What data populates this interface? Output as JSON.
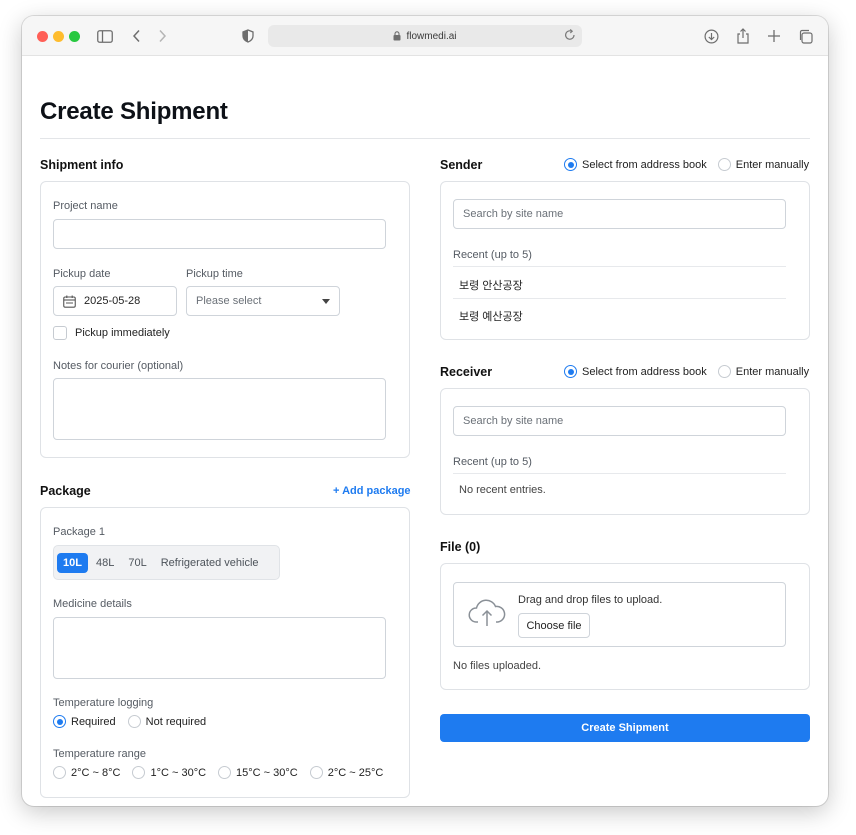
{
  "browser": {
    "url": "flowmedi.ai",
    "traffic_colors": [
      "#ff5f57",
      "#febc2e",
      "#28c840"
    ]
  },
  "page": {
    "title": "Create Shipment"
  },
  "shipment_info": {
    "title": "Shipment info",
    "project_name_label": "Project name",
    "project_name_value": "",
    "pickup_date_label": "Pickup date",
    "pickup_date_value": "2025-05-28",
    "pickup_time_label": "Pickup time",
    "pickup_time_placeholder": "Please select",
    "pickup_immediately_label": "Pickup immediately",
    "notes_label": "Notes for courier (optional)",
    "notes_value": ""
  },
  "package": {
    "title": "Package",
    "add_label": "+ Add package",
    "item_title": "Package 1",
    "sizes": [
      "10L",
      "48L",
      "70L",
      "Refrigerated vehicle"
    ],
    "selected_size": "10L",
    "medicine_label": "Medicine details",
    "temp_logging_label": "Temperature logging",
    "temp_logging_options": [
      "Required",
      "Not required"
    ],
    "temp_logging_selected": "Required",
    "temp_range_label": "Temperature range",
    "temp_range_options": [
      "2°C ~ 8°C",
      "1°C ~ 30°C",
      "15°C ~ 30°C",
      "2°C ~ 25°C"
    ]
  },
  "sender": {
    "title": "Sender",
    "mode_options": [
      "Select from address book",
      "Enter manually"
    ],
    "mode_selected": "Select from address book",
    "search_placeholder": "Search by site name",
    "recent_label": "Recent (up to 5)",
    "recent": [
      "보령 안산공장",
      "보령 예산공장"
    ]
  },
  "receiver": {
    "title": "Receiver",
    "mode_options": [
      "Select from address book",
      "Enter manually"
    ],
    "mode_selected": "Select from address book",
    "search_placeholder": "Search by site name",
    "recent_label": "Recent (up to 5)",
    "empty_text": "No recent entries."
  },
  "file": {
    "title": "File (0)",
    "dropzone_text": "Drag and drop files to upload.",
    "choose_label": "Choose file",
    "empty_text": "No files uploaded."
  },
  "actions": {
    "submit_label": "Create Shipment"
  },
  "colors": {
    "accent": "#1e7bf0",
    "border": "#dfe2e6"
  }
}
